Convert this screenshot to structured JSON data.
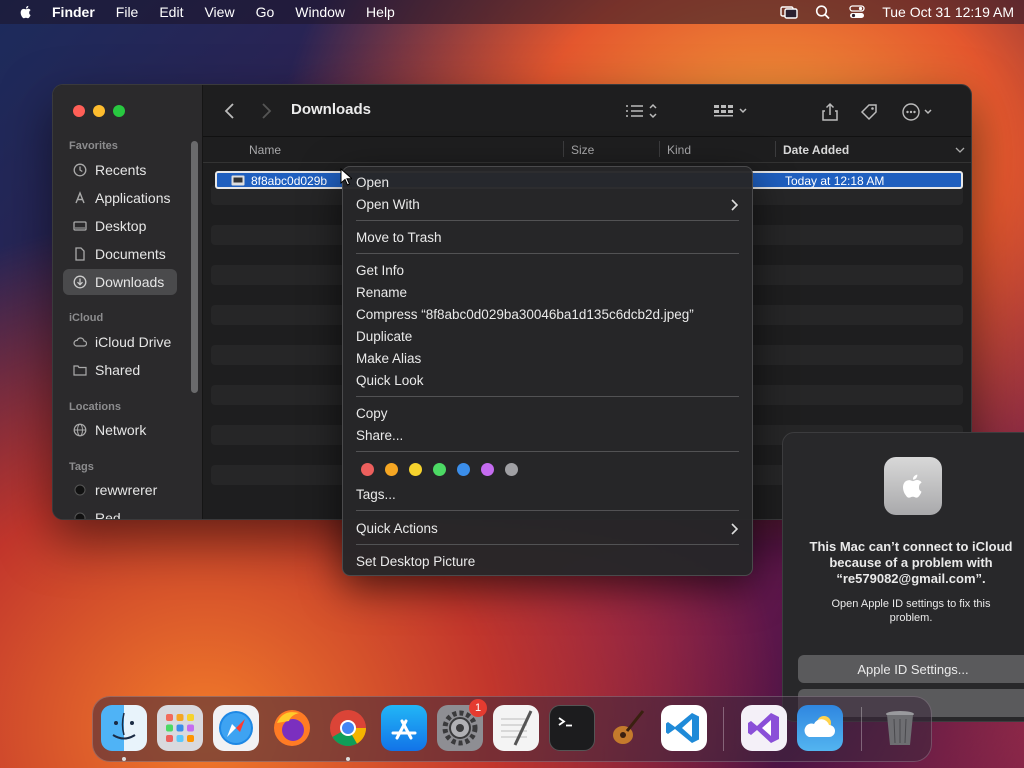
{
  "menubar": {
    "app_name": "Finder",
    "menus": [
      "File",
      "Edit",
      "View",
      "Go",
      "Window",
      "Help"
    ],
    "clock": "Tue Oct 31  12:19 AM"
  },
  "finder": {
    "title": "Downloads",
    "sidebar": {
      "favorites_label": "Favorites",
      "favorites": [
        "Recents",
        "Applications",
        "Desktop",
        "Documents",
        "Downloads"
      ],
      "icloud_label": "iCloud",
      "icloud": [
        "iCloud Drive",
        "Shared"
      ],
      "locations_label": "Locations",
      "locations": [
        "Network"
      ],
      "tags_label": "Tags",
      "tags": [
        "rewwrerer",
        "Red"
      ]
    },
    "columns": {
      "name": "Name",
      "size": "Size",
      "kind": "Kind",
      "date_added": "Date Added"
    },
    "selected_file": {
      "name": "8f8abc0d029b",
      "date_added": "Today at 12:18 AM"
    }
  },
  "context_menu": {
    "open": "Open",
    "open_with": "Open With",
    "move_to_trash": "Move to Trash",
    "get_info": "Get Info",
    "rename": "Rename",
    "compress": "Compress “8f8abc0d029ba30046ba1d135c6dcb2d.jpeg”",
    "duplicate": "Duplicate",
    "make_alias": "Make Alias",
    "quick_look": "Quick Look",
    "copy": "Copy",
    "share": "Share...",
    "tag_colors": [
      "#ec5f5d",
      "#f5a623",
      "#f6d32d",
      "#4cd964",
      "#3b8eea",
      "#c56cf0",
      "#a0a0a4"
    ],
    "tags": "Tags...",
    "quick_actions": "Quick Actions",
    "set_desktop_picture": "Set Desktop Picture"
  },
  "notification": {
    "title": "This Mac can’t connect to iCloud because of a problem with “re579082@gmail.com”.",
    "body": "Open Apple ID settings to fix this problem.",
    "button": "Apple ID Settings..."
  },
  "dock": {
    "apps": [
      "finder-icon",
      "launchpad-icon",
      "safari-icon",
      "firefox-icon",
      "chrome-icon",
      "app-store-icon",
      "system-settings-icon",
      "textedit-icon",
      "terminal-icon",
      "garageband-icon",
      "vscode-icon",
      "visual-studio-icon",
      "weather-icon",
      "trash-icon"
    ],
    "settings_badge": "1"
  }
}
